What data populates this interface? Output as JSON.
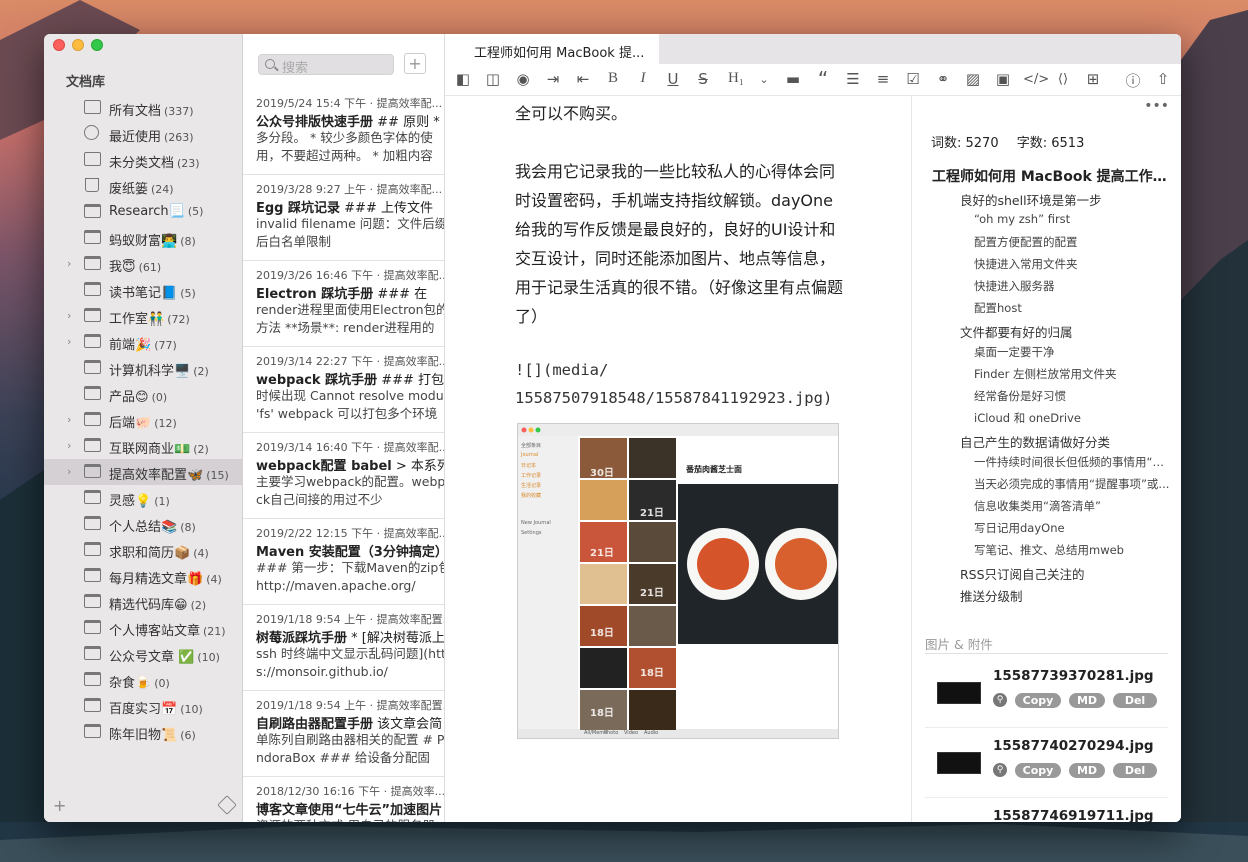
{
  "window": {
    "tab_title": "工程师如何用 MacBook 提..."
  },
  "sidebar": {
    "title": "文档库",
    "items": [
      {
        "label": "所有文档",
        "count": "(337)",
        "icon": "all-docs-icon"
      },
      {
        "label": "最近使用",
        "count": "(263)",
        "icon": "clock-icon"
      },
      {
        "label": "未分类文档",
        "count": "(23)",
        "icon": "unsorted-icon"
      },
      {
        "label": "废纸篓",
        "count": "(24)",
        "icon": "trash-icon"
      },
      {
        "label": "Research📃",
        "count": "(5)",
        "icon": "folder-icon"
      },
      {
        "label": "蚂蚁财富👨‍💻",
        "count": "(8)",
        "icon": "folder-icon"
      },
      {
        "label": "我😇",
        "count": "(61)",
        "icon": "folder-icon",
        "expandable": true
      },
      {
        "label": "读书笔记📘",
        "count": "(5)",
        "icon": "folder-icon"
      },
      {
        "label": "工作室👬",
        "count": "(72)",
        "icon": "folder-icon",
        "expandable": true
      },
      {
        "label": "前端🎉",
        "count": "(77)",
        "icon": "folder-icon",
        "expandable": true
      },
      {
        "label": "计算机科学🖥️",
        "count": "(2)",
        "icon": "folder-icon"
      },
      {
        "label": "产品😊",
        "count": "(0)",
        "icon": "folder-icon"
      },
      {
        "label": "后端🐖",
        "count": "(12)",
        "icon": "folder-icon",
        "expandable": true
      },
      {
        "label": "互联网商业💵",
        "count": "(2)",
        "icon": "folder-icon",
        "expandable": true
      },
      {
        "label": "提高效率配置🦋",
        "count": "(15)",
        "icon": "folder-icon",
        "expandable": true,
        "selected": true
      },
      {
        "label": "灵感💡",
        "count": "(1)",
        "icon": "folder-icon"
      },
      {
        "label": "个人总结📚",
        "count": "(8)",
        "icon": "folder-icon"
      },
      {
        "label": "求职和简历📦",
        "count": "(4)",
        "icon": "folder-icon"
      },
      {
        "label": "每月精选文章🎁",
        "count": "(4)",
        "icon": "folder-icon"
      },
      {
        "label": "精选代码库😁",
        "count": "(2)",
        "icon": "folder-icon"
      },
      {
        "label": "个人博客站文章",
        "count": "(21)",
        "icon": "folder-icon"
      },
      {
        "label": "公众号文章 ✅",
        "count": "(10)",
        "icon": "folder-icon"
      },
      {
        "label": "杂食🍺",
        "count": "(0)",
        "icon": "folder-icon"
      },
      {
        "label": "百度实习📅",
        "count": "(10)",
        "icon": "folder-icon"
      },
      {
        "label": "陈年旧物📜",
        "count": "(6)",
        "icon": "folder-icon"
      }
    ]
  },
  "search": {
    "placeholder": "搜索"
  },
  "notes": [
    {
      "meta": "2019/5/24 15:4 下午  · 提高效率配...",
      "title": "公众号排版快速手册",
      "rest": " ## 原则 *",
      "preview": "多分段。 * 较少多颜色字体的使用，不要超过两种。 * 加粗内容"
    },
    {
      "meta": "2019/3/28 9:27 上午  · 提高效率配...",
      "title": "Egg 踩坑记录",
      "rest": " ### 上传文件",
      "preview": "invalid filename  问题：文件后缀后白名单限制"
    },
    {
      "meta": "2019/3/26 16:46 下午  · 提高效率配...",
      "title": "Electron 踩坑手册",
      "rest": " ### 在",
      "preview": "render进程里面使用Electron包的方法  **场景**:  render进程用的"
    },
    {
      "meta": "2019/3/14 22:27 下午  · 提高效率配...",
      "title": "webpack 踩坑手册",
      "rest": " ### 打包的",
      "preview": "时候出现 Cannot resolve module 'fs'  webpack 可以打包多个环境"
    },
    {
      "meta": "2019/3/14 16:40 下午  · 提高效率配...",
      "title": "webpack配置 babel",
      "rest": "  > 本系列",
      "preview": "主要学习webpack的配置。webpack自己间接的用过不少"
    },
    {
      "meta": "2019/2/22 12:15 下午  · 提高效率配...",
      "title": "Maven 安装配置（3分钟搞定）",
      "rest": "",
      "preview": "### 第一步：下载Maven的zip包 http://maven.apache.org/"
    },
    {
      "meta": "2019/1/18 9:54 上午  · 提高效率配置...",
      "title": "树莓派踩坑手册",
      "rest": " * [解决树莓派上",
      "preview": "ssh 时终端中文显示乱码问题](https://monsoir.github.io/"
    },
    {
      "meta": "2019/1/18 9:54 上午  · 提高效率配置...",
      "title": "自刷路由器配置手册",
      "rest": " 该文章会简",
      "preview": "单陈列自刷路由器相关的配置 # PandoraBox ### 给设备分配固"
    },
    {
      "meta": "2018/12/30 16:16 下午  · 提高效率...",
      "title": "博客文章使用“七牛云”加速图片",
      "rest": "",
      "preview": "资源的两种方式  用自己的服务器"
    }
  ],
  "toolbar": {
    "heading_label": "H₁"
  },
  "document": {
    "para1": "全可以不购买。",
    "para2": "我会用它记录我的一些比较私人的心得体会同时设置密码，手机端支持指纹解锁。dayOne给我的写作反馈是最良好的，良好的UI设计和交互设计，同时还能添加图片、地点等信息，用于记录生活真的很不错。（好像这里有点偏题了）",
    "code1": "![](media/",
    "code2": "15587507918548/15587841192923.jpg)",
    "embed": {
      "post_title": "番茄肉酱芝士面",
      "side_items": [
        "全部条目",
        "Journal",
        "日记本",
        "工作记录",
        "生活记录",
        "我的收藏",
        "New Journal",
        "Settings"
      ],
      "date_labels": [
        "30日",
        "21日",
        "21日",
        "21日",
        "18日",
        "18日",
        "18日"
      ],
      "bottom_tabs": [
        "All/Memo",
        "Photo",
        "Video",
        "Audio"
      ]
    }
  },
  "panel": {
    "word_count": "词数: 5270",
    "char_count": "字数: 6513",
    "toc": [
      {
        "level": 1,
        "text": "工程师如何用 MacBook 提高工作..."
      },
      {
        "level": 2,
        "text": "良好的shell环境是第一步"
      },
      {
        "level": 3,
        "text": "“oh my zsh” first"
      },
      {
        "level": 3,
        "text": "配置方便配置的配置"
      },
      {
        "level": 3,
        "text": "快捷进入常用文件夹"
      },
      {
        "level": 3,
        "text": "快捷进入服务器"
      },
      {
        "level": 3,
        "text": "配置host"
      },
      {
        "level": 2,
        "text": "文件都要有好的归属"
      },
      {
        "level": 3,
        "text": "桌面一定要干净"
      },
      {
        "level": 3,
        "text": "Finder 左侧栏放常用文件夹"
      },
      {
        "level": 3,
        "text": "经常备份是好习惯"
      },
      {
        "level": 3,
        "text": "iCloud 和 oneDrive"
      },
      {
        "level": 2,
        "text": "自己产生的数据请做好分类"
      },
      {
        "level": 3,
        "text": "一件持续时间很长但低频的事情用“备..."
      },
      {
        "level": 3,
        "text": "当天必须完成的事情用“提醒事项”或..."
      },
      {
        "level": 3,
        "text": "信息收集类用“滴答清单”"
      },
      {
        "level": 3,
        "text": "写日记用dayOne"
      },
      {
        "level": 3,
        "text": "写笔记、推文、总结用mweb"
      },
      {
        "level": 2,
        "text": "RSS只订阅自己关注的"
      },
      {
        "level": 2,
        "text": "推送分级制"
      }
    ],
    "attachments_title": "图片 & 附件",
    "attachments": [
      {
        "name": "15587739370281.jpg"
      },
      {
        "name": "15587740270294.jpg"
      },
      {
        "name": "15587746919711.jpg"
      }
    ],
    "copy_label": "Copy",
    "md_label": "MD",
    "del_label": "Del"
  }
}
